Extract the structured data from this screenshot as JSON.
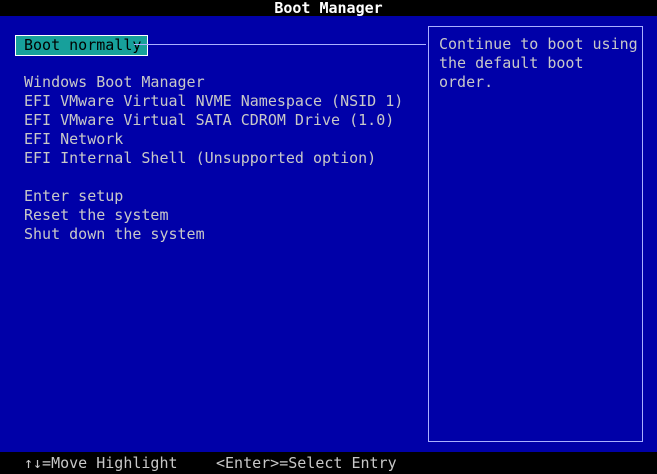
{
  "title": "Boot Manager",
  "selected_item": "Boot normally",
  "boot_entries": [
    "Windows Boot Manager",
    "EFI VMware Virtual NVME Namespace (NSID 1)",
    "EFI VMware Virtual SATA CDROM Drive (1.0)",
    "EFI Network",
    "EFI Internal Shell (Unsupported option)"
  ],
  "system_entries": [
    "Enter setup",
    "Reset the system",
    "Shut down the system"
  ],
  "help_text": "Continue to boot using the default boot order.",
  "footer": {
    "move_hint": "↑↓=Move Highlight",
    "select_hint": "<Enter>=Select Entry"
  },
  "colors": {
    "background": "#0000a8",
    "highlight": "#17a09b",
    "text": "#c8c8c8"
  }
}
